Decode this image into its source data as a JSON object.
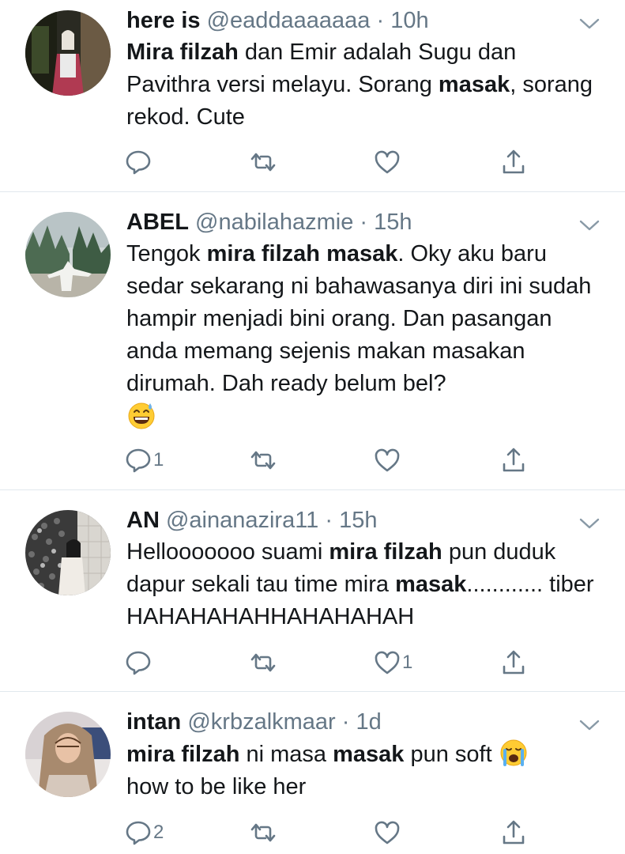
{
  "tweets": [
    {
      "name": "here is",
      "handle": "@eaddaaaaaaa",
      "dot": "·",
      "time": "10h",
      "segments": [
        {
          "t": "Mira filzah",
          "b": true
        },
        {
          "t": " dan Emir adalah Sugu dan Pavithra versi melayu. Sorang ",
          "b": false
        },
        {
          "t": "masak",
          "b": true
        },
        {
          "t": ", sorang rekod. Cute",
          "b": false
        }
      ],
      "emoji": "",
      "reply_count": "",
      "retweet_count": "",
      "like_count": ""
    },
    {
      "name": "ABEL",
      "handle": "@nabilahazmie",
      "dot": "·",
      "time": "15h",
      "segments": [
        {
          "t": "Tengok ",
          "b": false
        },
        {
          "t": "mira filzah masak",
          "b": true
        },
        {
          "t": ". Oky aku baru sedar sekarang ni bahawasanya diri ini sudah hampir menjadi bini orang. Dan pasangan anda memang sejenis makan masakan dirumah. Dah ready belum bel?",
          "b": false
        }
      ],
      "emoji": "grinning-sweat",
      "reply_count": "1",
      "retweet_count": "",
      "like_count": ""
    },
    {
      "name": "AN",
      "handle": "@ainanazira11",
      "dot": "·",
      "time": "15h",
      "segments": [
        {
          "t": "Hellooooooo suami ",
          "b": false
        },
        {
          "t": "mira filzah",
          "b": true
        },
        {
          "t": " pun duduk dapur sekali tau time mira ",
          "b": false
        },
        {
          "t": "masak",
          "b": true
        },
        {
          "t": "............ tiber HAHAHAHAHHAHAHAHAH",
          "b": false
        }
      ],
      "emoji": "",
      "reply_count": "",
      "retweet_count": "",
      "like_count": "1"
    },
    {
      "name": "intan",
      "handle": "@krbzalkmaar",
      "dot": "·",
      "time": "1d",
      "segments": [
        {
          "t": "mira filzah",
          "b": true
        },
        {
          "t": " ni masa ",
          "b": false
        },
        {
          "t": "masak",
          "b": true
        },
        {
          "t": " pun soft ",
          "b": false
        },
        {
          "t": "[crying-emoji]",
          "b": false
        },
        {
          "t": " how to be like her",
          "b": false
        }
      ],
      "emoji": "",
      "reply_count": "2",
      "retweet_count": "",
      "like_count": ""
    }
  ],
  "icons": {
    "reply": "reply-icon",
    "retweet": "retweet-icon",
    "like": "heart-icon",
    "share": "share-icon",
    "caret": "chevron-down-icon"
  },
  "colors": {
    "icon_gray": "#657786",
    "divider": "#e1e8ed",
    "text": "#14171a"
  }
}
